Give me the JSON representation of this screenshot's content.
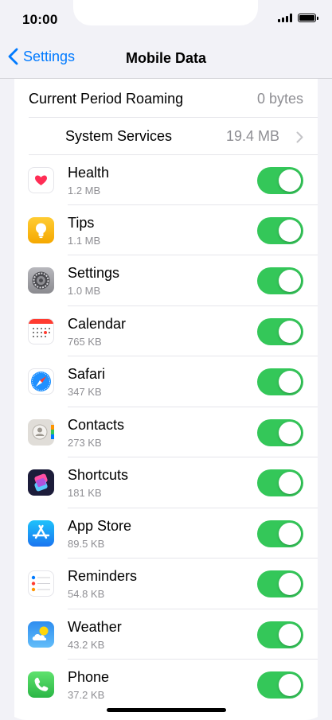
{
  "status": {
    "time": "10:00"
  },
  "nav": {
    "back_label": "Settings",
    "title": "Mobile Data"
  },
  "roaming": {
    "label": "Current Period Roaming",
    "value": "0 bytes"
  },
  "system_services": {
    "label": "System Services",
    "value": "19.4 MB"
  },
  "apps": [
    {
      "name": "Health",
      "size": "1.2 MB",
      "icon": "health-icon",
      "enabled": true
    },
    {
      "name": "Tips",
      "size": "1.1 MB",
      "icon": "tips-icon",
      "enabled": true
    },
    {
      "name": "Settings",
      "size": "1.0 MB",
      "icon": "settings-gear-icon",
      "enabled": true
    },
    {
      "name": "Calendar",
      "size": "765 KB",
      "icon": "calendar-icon",
      "enabled": true
    },
    {
      "name": "Safari",
      "size": "347 KB",
      "icon": "safari-icon",
      "enabled": true
    },
    {
      "name": "Contacts",
      "size": "273 KB",
      "icon": "contacts-icon",
      "enabled": true
    },
    {
      "name": "Shortcuts",
      "size": "181 KB",
      "icon": "shortcuts-icon",
      "enabled": true
    },
    {
      "name": "App Store",
      "size": "89.5 KB",
      "icon": "app-store-icon",
      "enabled": true
    },
    {
      "name": "Reminders",
      "size": "54.8 KB",
      "icon": "reminders-icon",
      "enabled": true
    },
    {
      "name": "Weather",
      "size": "43.2 KB",
      "icon": "weather-icon",
      "enabled": true
    },
    {
      "name": "Phone",
      "size": "37.2 KB",
      "icon": "phone-icon",
      "enabled": true
    }
  ],
  "colors": {
    "accent": "#007aff",
    "toggle_on": "#34c759",
    "secondary_text": "#8e8e93"
  }
}
